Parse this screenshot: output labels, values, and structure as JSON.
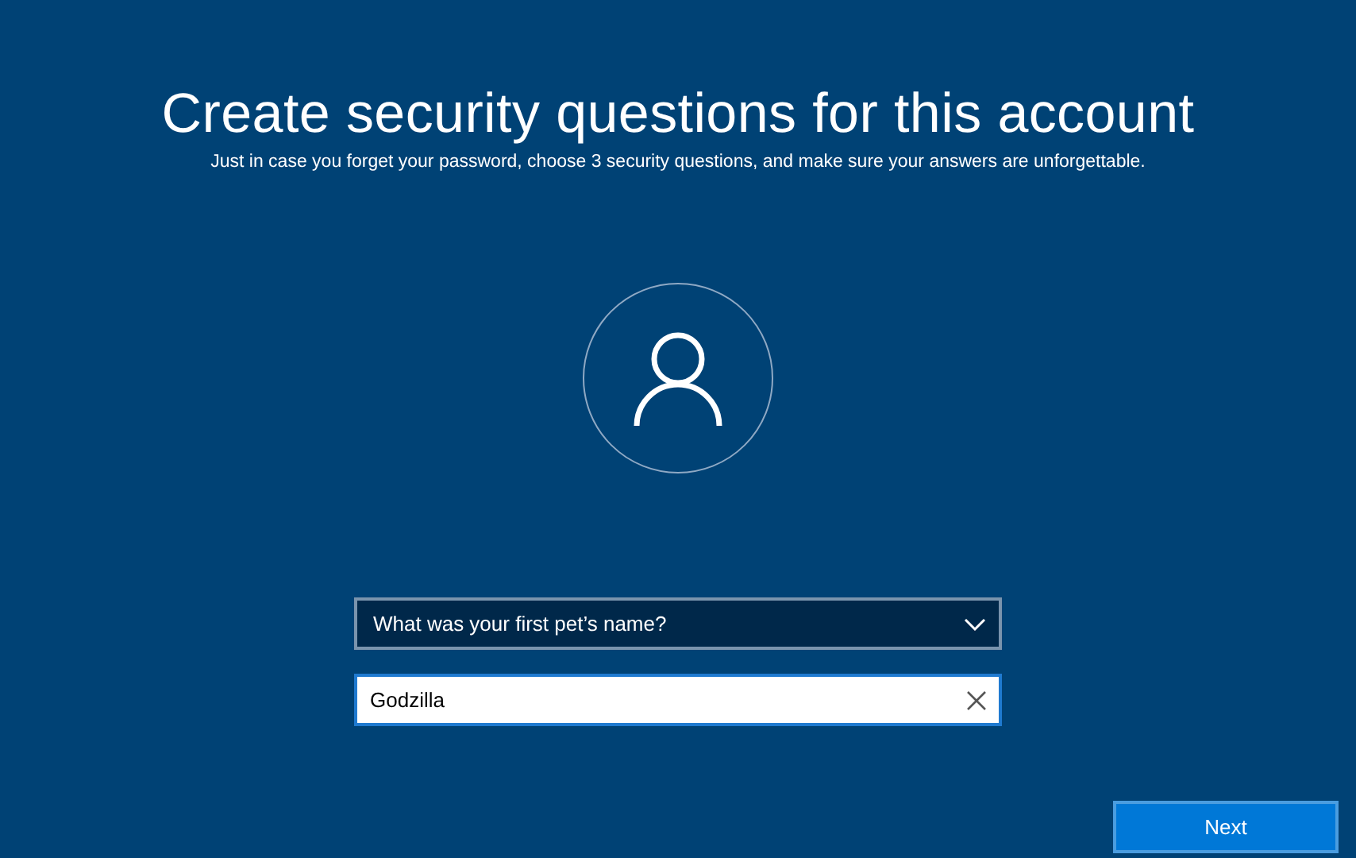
{
  "title": "Create security questions for this account",
  "subtitle": "Just in case you forget your password, choose 3 security questions, and make sure your answers are unforgettable.",
  "question_dropdown": {
    "value": "What was your first pet’s name?"
  },
  "answer_field": {
    "value": "Godzilla"
  },
  "buttons": [
    "Next"
  ]
}
